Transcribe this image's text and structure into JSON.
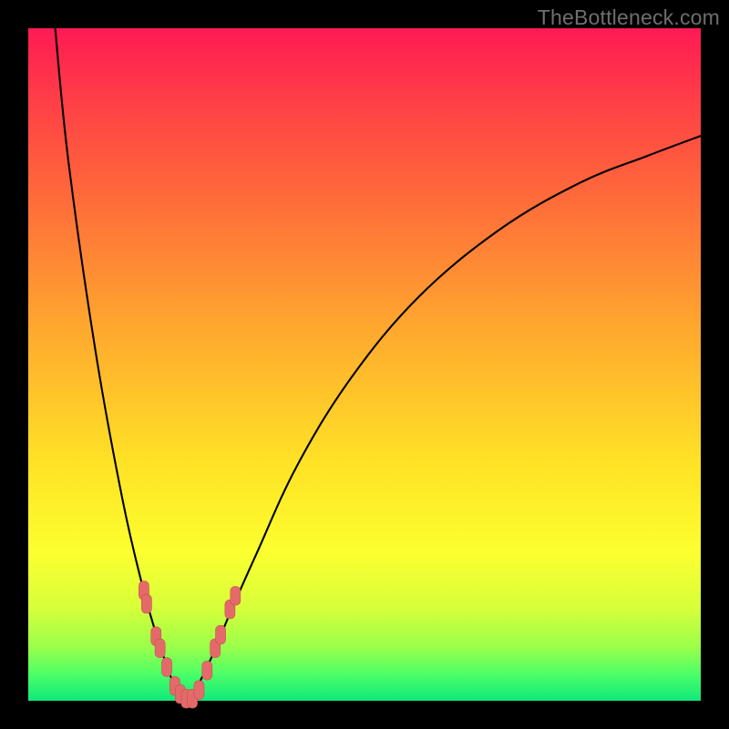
{
  "watermark": "TheBottleneck.com",
  "chart_data": {
    "type": "line",
    "title": "",
    "xlabel": "",
    "ylabel": "",
    "xlim": [
      0,
      1
    ],
    "ylim": [
      0,
      1
    ],
    "legend": false,
    "grid": false,
    "background_gradient": {
      "orientation": "vertical",
      "stops": [
        {
          "pos": 0.0,
          "color": "#ff1a54"
        },
        {
          "pos": 0.25,
          "color": "#ff6a3a"
        },
        {
          "pos": 0.5,
          "color": "#ffc72a"
        },
        {
          "pos": 0.75,
          "color": "#fcff2f"
        },
        {
          "pos": 0.92,
          "color": "#9bff4a"
        },
        {
          "pos": 1.0,
          "color": "#10e87a"
        }
      ]
    },
    "series": [
      {
        "name": "bottleneck-curve",
        "x": [
          0.04,
          0.06,
          0.1,
          0.14,
          0.17,
          0.19,
          0.205,
          0.215,
          0.225,
          0.235,
          0.245,
          0.255,
          0.275,
          0.3,
          0.34,
          0.4,
          0.48,
          0.58,
          0.7,
          0.82,
          0.92,
          1.0
        ],
        "y": [
          1.0,
          0.8,
          0.52,
          0.3,
          0.17,
          0.1,
          0.055,
          0.028,
          0.01,
          0.003,
          0.01,
          0.028,
          0.07,
          0.13,
          0.22,
          0.35,
          0.48,
          0.6,
          0.7,
          0.77,
          0.81,
          0.84
        ],
        "color": "#000000"
      }
    ],
    "markers": [
      {
        "x": 0.172,
        "y": 0.164
      },
      {
        "x": 0.176,
        "y": 0.144
      },
      {
        "x": 0.19,
        "y": 0.096
      },
      {
        "x": 0.196,
        "y": 0.078
      },
      {
        "x": 0.206,
        "y": 0.05
      },
      {
        "x": 0.218,
        "y": 0.022
      },
      {
        "x": 0.226,
        "y": 0.01
      },
      {
        "x": 0.235,
        "y": 0.003
      },
      {
        "x": 0.244,
        "y": 0.003
      },
      {
        "x": 0.254,
        "y": 0.016
      },
      {
        "x": 0.266,
        "y": 0.045
      },
      {
        "x": 0.278,
        "y": 0.078
      },
      {
        "x": 0.286,
        "y": 0.098
      },
      {
        "x": 0.3,
        "y": 0.136
      },
      {
        "x": 0.308,
        "y": 0.156
      }
    ],
    "marker_style": {
      "color": "#e46a6a",
      "shape": "rounded-rect",
      "width": 0.015,
      "height": 0.028
    }
  }
}
